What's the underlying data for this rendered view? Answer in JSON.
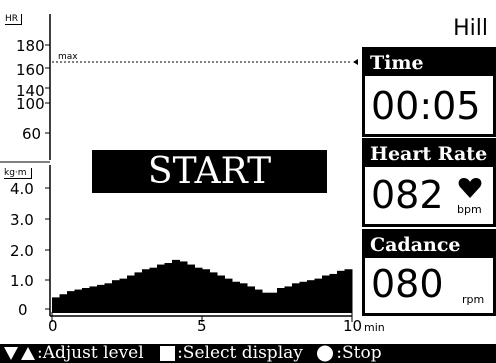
{
  "program_name": "Hill",
  "hr_axis": {
    "unit": "HR",
    "ticks": [
      "180",
      "160",
      "140",
      "100",
      "60"
    ],
    "max_label": "max"
  },
  "load_axis": {
    "unit": "kg·m",
    "ticks": [
      "4.0",
      "3.0",
      "2.0",
      "1.0",
      "0"
    ]
  },
  "x_axis": {
    "ticks": [
      "0",
      "5",
      "10"
    ],
    "unit": "min"
  },
  "start_banner": "START",
  "panels": {
    "time": {
      "label": "Time",
      "value": "00:05"
    },
    "heart_rate": {
      "label": "Heart Rate",
      "value": "082",
      "unit": "bpm",
      "icon": "heart-icon"
    },
    "cadence": {
      "label": "Cadance",
      "value": "080",
      "unit": "rpm"
    }
  },
  "footer": {
    "adjust": ":Adjust level",
    "select": ":Select display",
    "stop": ":Stop"
  },
  "chart_data": {
    "type": "bar",
    "x": [
      0.0,
      0.25,
      0.5,
      0.75,
      1.0,
      1.25,
      1.5,
      1.75,
      2.0,
      2.25,
      2.5,
      2.75,
      3.0,
      3.25,
      3.5,
      3.75,
      4.0,
      4.25,
      4.5,
      4.75,
      5.0,
      5.25,
      5.5,
      5.75,
      6.0,
      6.25,
      6.5,
      6.75,
      7.0,
      7.25,
      7.5,
      7.75,
      8.0,
      8.25,
      8.5,
      8.75,
      9.0,
      9.25,
      9.5,
      9.75
    ],
    "values": [
      0.5,
      0.6,
      0.7,
      0.75,
      0.8,
      0.85,
      0.9,
      0.95,
      1.05,
      1.1,
      1.2,
      1.3,
      1.4,
      1.45,
      1.55,
      1.6,
      1.7,
      1.65,
      1.55,
      1.45,
      1.4,
      1.3,
      1.2,
      1.1,
      1.0,
      0.95,
      0.85,
      0.75,
      0.65,
      0.65,
      0.8,
      0.85,
      0.95,
      1.0,
      1.05,
      1.1,
      1.2,
      1.25,
      1.35,
      1.4
    ],
    "xlim": [
      0,
      10
    ],
    "ylim": [
      0,
      4.5
    ],
    "xlabel": "min",
    "ylabel": "kg·m",
    "max_hr": 157
  }
}
